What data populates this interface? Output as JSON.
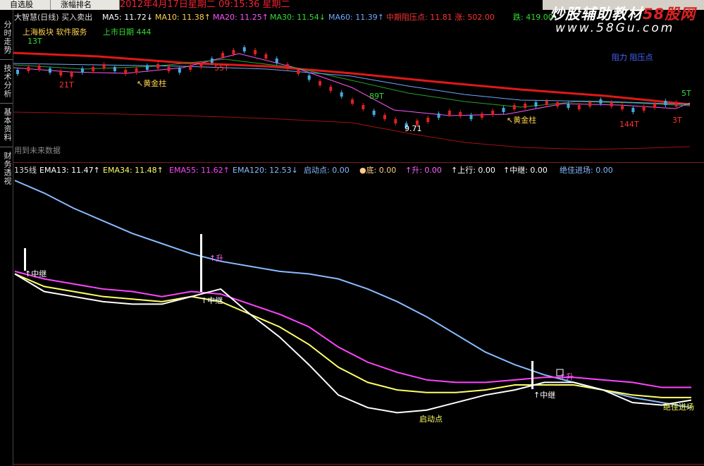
{
  "toolbar": {
    "tab1": "自选股",
    "tab2": "涨幅排名",
    "date_text": "2012年4月17日星期二  09:15:36 星期二"
  },
  "banner": {
    "title_a": "炒股辅助教材",
    "title_b": "58股网",
    "url": "www.58Gu.com"
  },
  "sidebar": {
    "tabs": [
      "分时走势",
      "技术分析",
      "基本资料",
      "财务透视"
    ]
  },
  "upper": {
    "stock_title": "大智慧(日线) 买入卖出",
    "ma_labels": [
      {
        "text": "MA5: 11.72↓",
        "color": "#ffffff"
      },
      {
        "text": "MA10: 11.38↑",
        "color": "#ffd24d"
      },
      {
        "text": "MA20: 11.25↑",
        "color": "#ff55ff"
      },
      {
        "text": "MA30: 11.54↓",
        "color": "#33dd33"
      },
      {
        "text": "MA60: 11.39↑",
        "color": "#6fa8ff"
      },
      {
        "text": "中期阻压点: 11.81 涨: 502.00",
        "color": "#ff3333"
      },
      {
        "text": "跌: 419.00",
        "color": "#33dd33"
      }
    ],
    "sector_line": "上海板块  软件服务",
    "listing_date": "上市日期 444",
    "watermark_note": "用到未来数据",
    "band_label": "阻力  阻压点",
    "annotations": [
      {
        "text": "13T",
        "color": "#33dd33"
      },
      {
        "text": "21T",
        "color": "#ff3333"
      },
      {
        "text": "↖黄金柱",
        "color": "#ffd24d"
      },
      {
        "text": "↖黄金柱",
        "color": "#ffd24d"
      },
      {
        "text": "55T",
        "color": "#ff3333"
      },
      {
        "text": "89T",
        "color": "#33dd33"
      },
      {
        "text": "9.71",
        "color": "#ffffff"
      },
      {
        "text": "144T",
        "color": "#ff3333"
      },
      {
        "text": "5T",
        "color": "#33dd33"
      },
      {
        "text": "3T",
        "color": "#ff3333"
      }
    ]
  },
  "lower": {
    "indicator_labels": [
      {
        "text": "135线",
        "color": "#dddddd"
      },
      {
        "text": "EMA13: 11.47↑",
        "color": "#ffffff"
      },
      {
        "text": "EMA34: 11.48↑",
        "color": "#ffff66"
      },
      {
        "text": "EMA55: 11.62↑",
        "color": "#ff44ff"
      },
      {
        "text": "EMA120: 12.53↓",
        "color": "#88bbff"
      },
      {
        "text": "启动点: 0.00",
        "color": "#88bbff"
      },
      {
        "text": "●底: 0.00",
        "color": "#ffcc88"
      },
      {
        "text": "↑升: 0.00",
        "color": "#ff66ff"
      },
      {
        "text": "↑上行: 0.00",
        "color": "#ffffff"
      },
      {
        "text": "↑中继: 0.00",
        "color": "#ffffff"
      },
      {
        "text": "绝佳进场: 0.00",
        "color": "#88bbff"
      }
    ],
    "markers": [
      {
        "text": "↑中继",
        "color": "#ffffff"
      },
      {
        "text": "↑升",
        "color": "#ff66ff"
      },
      {
        "text": "↑中继",
        "color": "#ffffff"
      },
      {
        "text": "启动点",
        "color": "#ffff66"
      },
      {
        "text": "↑中继",
        "color": "#ffffff"
      },
      {
        "text": "↑升",
        "color": "#ff66ff"
      },
      {
        "text": "绝佳进场",
        "color": "#ffff66"
      }
    ]
  },
  "chart_data": {
    "type": "line",
    "series": [
      {
        "name": "EMA120",
        "color": "#88bbff",
        "values": [
          0.0,
          0.5,
          1.1,
          1.6,
          2.1,
          2.5,
          2.9,
          3.2,
          3.4,
          3.6,
          3.7,
          3.9,
          4.3,
          4.8,
          5.4,
          6.1,
          6.8,
          7.3,
          7.7,
          8.0,
          8.3,
          8.6,
          8.8,
          9.0
        ]
      },
      {
        "name": "EMA55",
        "color": "#ff44ff",
        "values": [
          3.6,
          3.9,
          4.1,
          4.3,
          4.4,
          4.6,
          4.4,
          4.5,
          4.9,
          5.3,
          5.8,
          6.6,
          7.2,
          7.6,
          7.9,
          8.0,
          8.0,
          7.9,
          7.8,
          7.8,
          7.9,
          8.0,
          8.2,
          8.2
        ]
      },
      {
        "name": "EMA34",
        "color": "#ffff66",
        "values": [
          3.7,
          4.2,
          4.4,
          4.6,
          4.7,
          4.8,
          4.6,
          4.8,
          5.3,
          5.8,
          6.5,
          7.4,
          8.0,
          8.3,
          8.4,
          8.4,
          8.3,
          8.1,
          8.1,
          8.1,
          8.3,
          8.5,
          8.6,
          8.6
        ]
      },
      {
        "name": "EMA13",
        "color": "#ffffff",
        "values": [
          3.7,
          4.4,
          4.6,
          4.8,
          4.9,
          4.9,
          4.6,
          4.3,
          5.3,
          6.2,
          7.3,
          8.5,
          9.0,
          9.2,
          9.1,
          8.8,
          8.5,
          8.3,
          8.0,
          8.0,
          8.3,
          8.8,
          8.9,
          8.7
        ]
      }
    ]
  }
}
